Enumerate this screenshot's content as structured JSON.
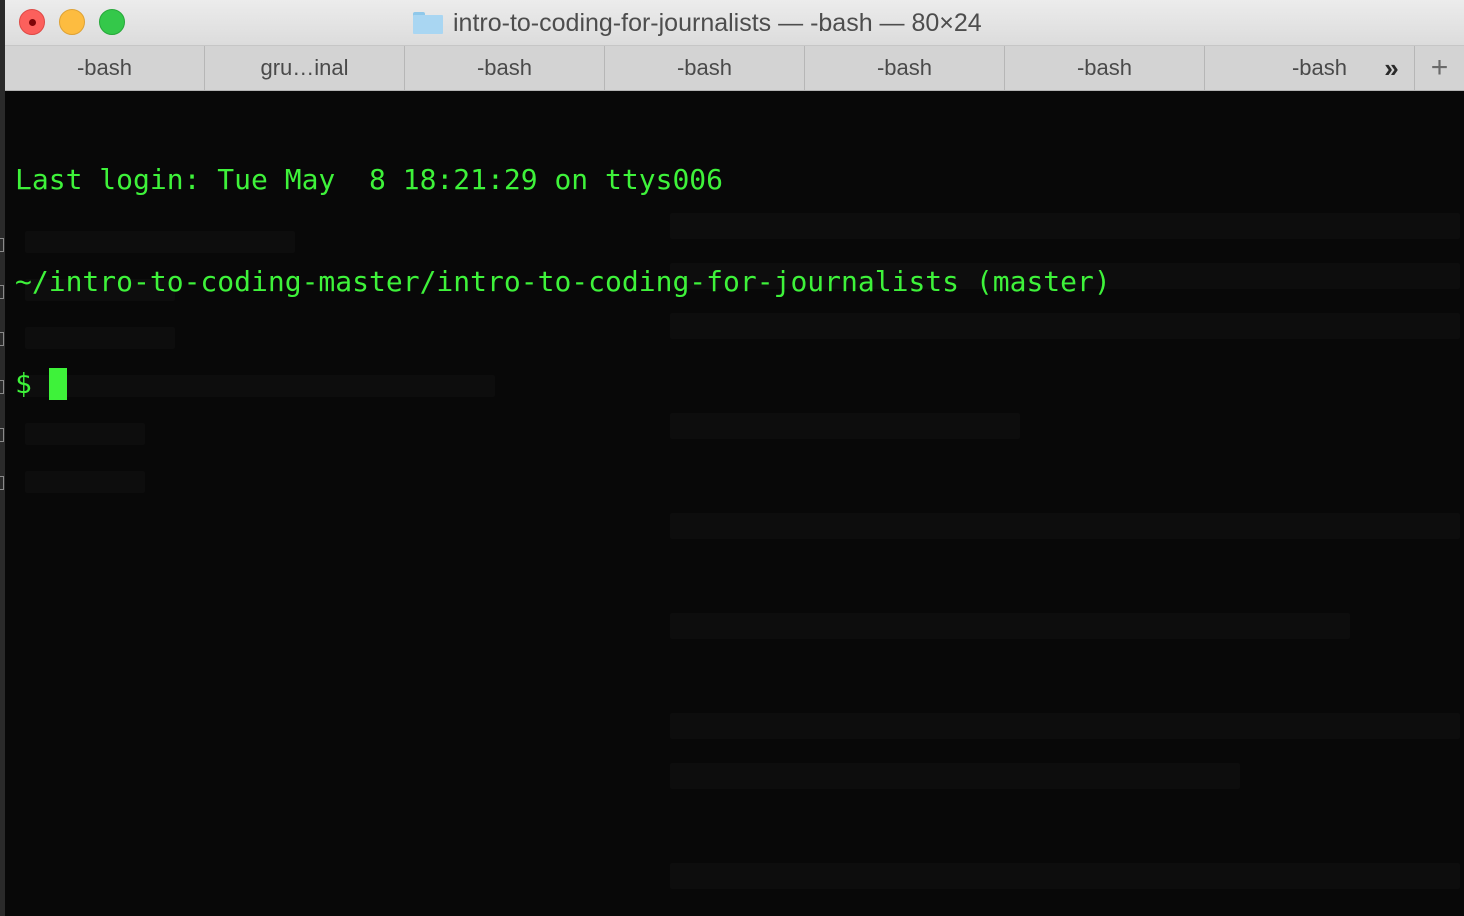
{
  "window": {
    "title": "intro-to-coding-for-journalists — -bash — 80×24"
  },
  "tabs": [
    {
      "label": "-bash"
    },
    {
      "label": "gru…inal"
    },
    {
      "label": "-bash"
    },
    {
      "label": "-bash"
    },
    {
      "label": "-bash"
    },
    {
      "label": "-bash"
    },
    {
      "label": "-bash"
    }
  ],
  "tab_overflow_label": "»",
  "tab_add_label": "+",
  "terminal": {
    "lines": [
      "Last login: Tue May  8 18:21:29 on ttys006",
      "~/intro-to-coding-master/intro-to-coding-for-journalists (master)"
    ],
    "prompt": "$ ",
    "text_color": "#3ef23a",
    "background_color": "#080808"
  },
  "colors": {
    "close": "#fc605c",
    "minimize": "#fdbc40",
    "maximize": "#34c84a"
  }
}
